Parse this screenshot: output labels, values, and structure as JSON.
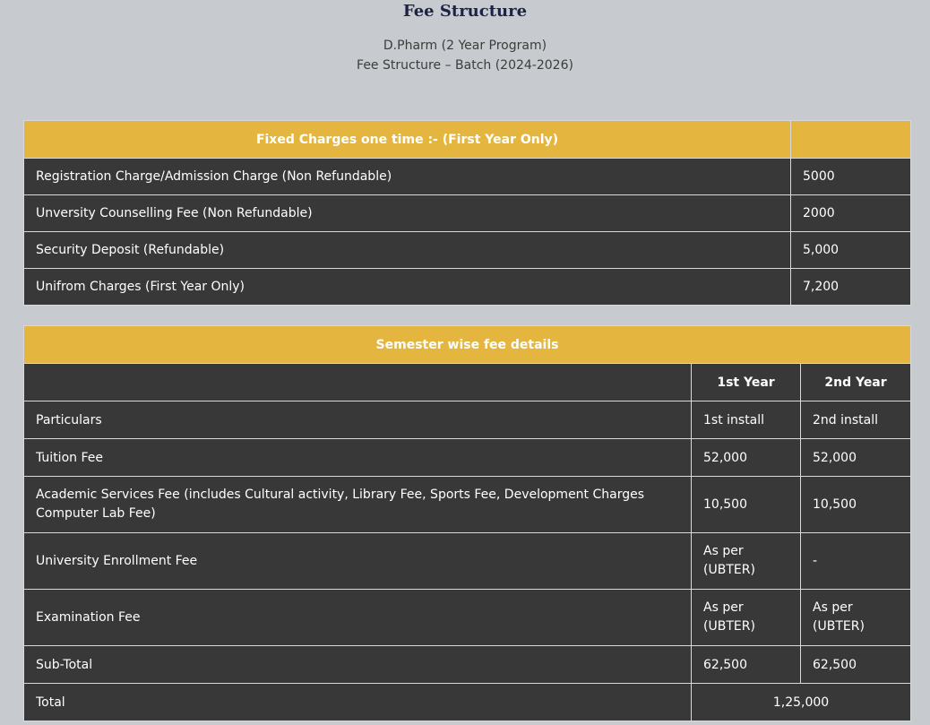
{
  "header": {
    "title": "Fee Structure",
    "program": "D.Pharm (2 Year Program)",
    "batch": "Fee Structure – Batch (2024-2026)"
  },
  "fixed_charges": {
    "heading": "Fixed Charges one time :- (First Year Only)",
    "rows": [
      {
        "label": "Registration Charge/Admission Charge (Non Refundable)",
        "amount": "5000"
      },
      {
        "label": "Unversity Counselling Fee (Non Refundable)",
        "amount": "2000"
      },
      {
        "label": "Security Deposit (Refundable)",
        "amount": "5,000"
      },
      {
        "label": "Unifrom Charges (First Year Only)",
        "amount": "7,200"
      }
    ]
  },
  "semester": {
    "heading": "Semester wise fee details",
    "year1": "1st Year",
    "year2": "2nd Year",
    "rows": [
      {
        "label": "Particulars",
        "y1": "1st install",
        "y2": "2nd install"
      },
      {
        "label": "Tuition Fee",
        "y1": "52,000",
        "y2": "52,000"
      },
      {
        "label": "Academic Services Fee (includes Cultural activity, Library Fee, Sports Fee, Development Charges Computer Lab Fee)",
        "y1": "10,500",
        "y2": "10,500"
      },
      {
        "label": "University Enrollment Fee",
        "y1": "As per (UBTER)",
        "y2": "-"
      },
      {
        "label": "Examination Fee",
        "y1": "As per (UBTER)",
        "y2": "As per (UBTER)"
      },
      {
        "label": "Sub-Total",
        "y1": "62,500",
        "y2": "62,500"
      }
    ],
    "total": {
      "label": "Total",
      "value": "1,25,000"
    }
  }
}
